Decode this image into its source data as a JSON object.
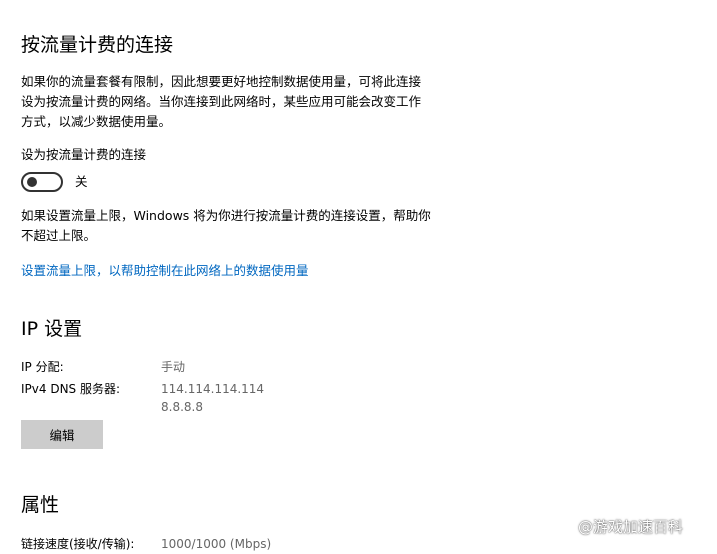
{
  "metered": {
    "title": "按流量计费的连接",
    "description": "如果你的流量套餐有限制，因此想要更好地控制数据使用量，可将此连接设为按流量计费的网络。当你连接到此网络时，某些应用可能会改变工作方式，以减少数据使用量。",
    "toggle_label": "设为按流量计费的连接",
    "toggle_state": "关",
    "limit_note": "如果设置流量上限，Windows 将为你进行按流量计费的连接设置，帮助你不超过上限。",
    "limit_link": "设置流量上限，以帮助控制在此网络上的数据使用量"
  },
  "ip": {
    "title": "IP 设置",
    "assignment_label": "IP 分配:",
    "assignment_value": "手动",
    "dns_label": "IPv4 DNS 服务器:",
    "dns_primary": "114.114.114.114",
    "dns_secondary": "8.8.8.8",
    "edit_button": "编辑"
  },
  "properties": {
    "title": "属性",
    "link_speed_label": "链接速度(接收/传输):",
    "link_speed_value": "1000/1000 (Mbps)"
  },
  "watermark": {
    "text": "@游戏加速百科"
  },
  "colors": {
    "link": "#0067c0",
    "button_bg": "#cccccc",
    "secondary_text": "#666666"
  }
}
